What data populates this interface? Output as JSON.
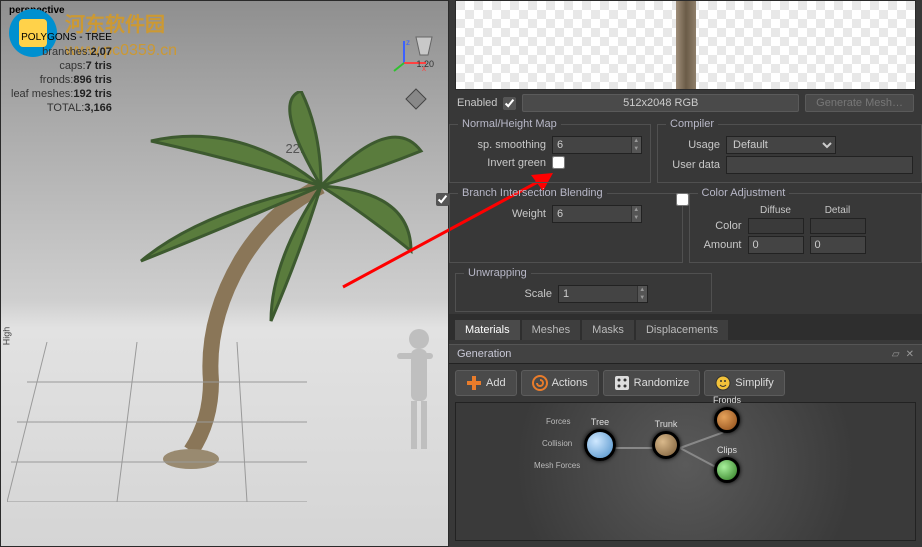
{
  "viewport": {
    "mode_label": "perspective",
    "polystats_header": "POLYGONS - TREE",
    "stats": {
      "branches_label": "branches:",
      "branches_tris": "2,07",
      "caps_label": "caps:",
      "caps_tris": "7 tris",
      "fronds_label": "fronds:",
      "fronds_tris": "896 tris",
      "leafmeshes_label": "leaf meshes:",
      "leafmeshes_tris": "192 tris",
      "total_label": "TOTAL:",
      "total_tris": "3,166"
    },
    "height_value": "22.17",
    "light_intensity": "1.20",
    "vertical_label": "High",
    "watermark_title": "河东软件园",
    "watermark_url": "www.pc0359.cn"
  },
  "texture_bar": {
    "enabled_label": "Enabled",
    "enabled_checked": true,
    "resolution_btn": "512x2048  RGB",
    "generate_btn": "Generate Mesh…"
  },
  "normal_height": {
    "legend": "Normal/Height Map",
    "smoothing_label": "sp. smoothing",
    "smoothing_value": "6",
    "invert_label": "Invert green",
    "invert_checked": false
  },
  "compiler": {
    "legend": "Compiler",
    "usage_label": "Usage",
    "usage_value": "Default",
    "userdata_label": "User data",
    "userdata_value": ""
  },
  "branch_blend": {
    "legend": "Branch Intersection Blending",
    "enabled": true,
    "weight_label": "Weight",
    "weight_value": "6"
  },
  "color_adj": {
    "legend": "Color Adjustment",
    "enabled": false,
    "diffuse_header": "Diffuse",
    "detail_header": "Detail",
    "color_label": "Color",
    "amount_label": "Amount",
    "amount_diffuse": "0",
    "amount_detail": "0"
  },
  "unwrapping": {
    "legend": "Unwrapping",
    "scale_label": "Scale",
    "scale_value": "1"
  },
  "tabs": {
    "materials": "Materials",
    "meshes": "Meshes",
    "masks": "Masks",
    "displacements": "Displacements",
    "active": "materials"
  },
  "generation": {
    "header": "Generation",
    "add_btn": "Add",
    "actions_btn": "Actions",
    "randomize_btn": "Randomize",
    "simplify_btn": "Simplify",
    "nodes": {
      "tree": "Tree",
      "trunk": "Trunk",
      "fronds": "Fronds",
      "clips": "Clips",
      "mini_forces": "Forces",
      "mini_collision": "Collision",
      "mini_meshforces": "Mesh Forces"
    }
  }
}
